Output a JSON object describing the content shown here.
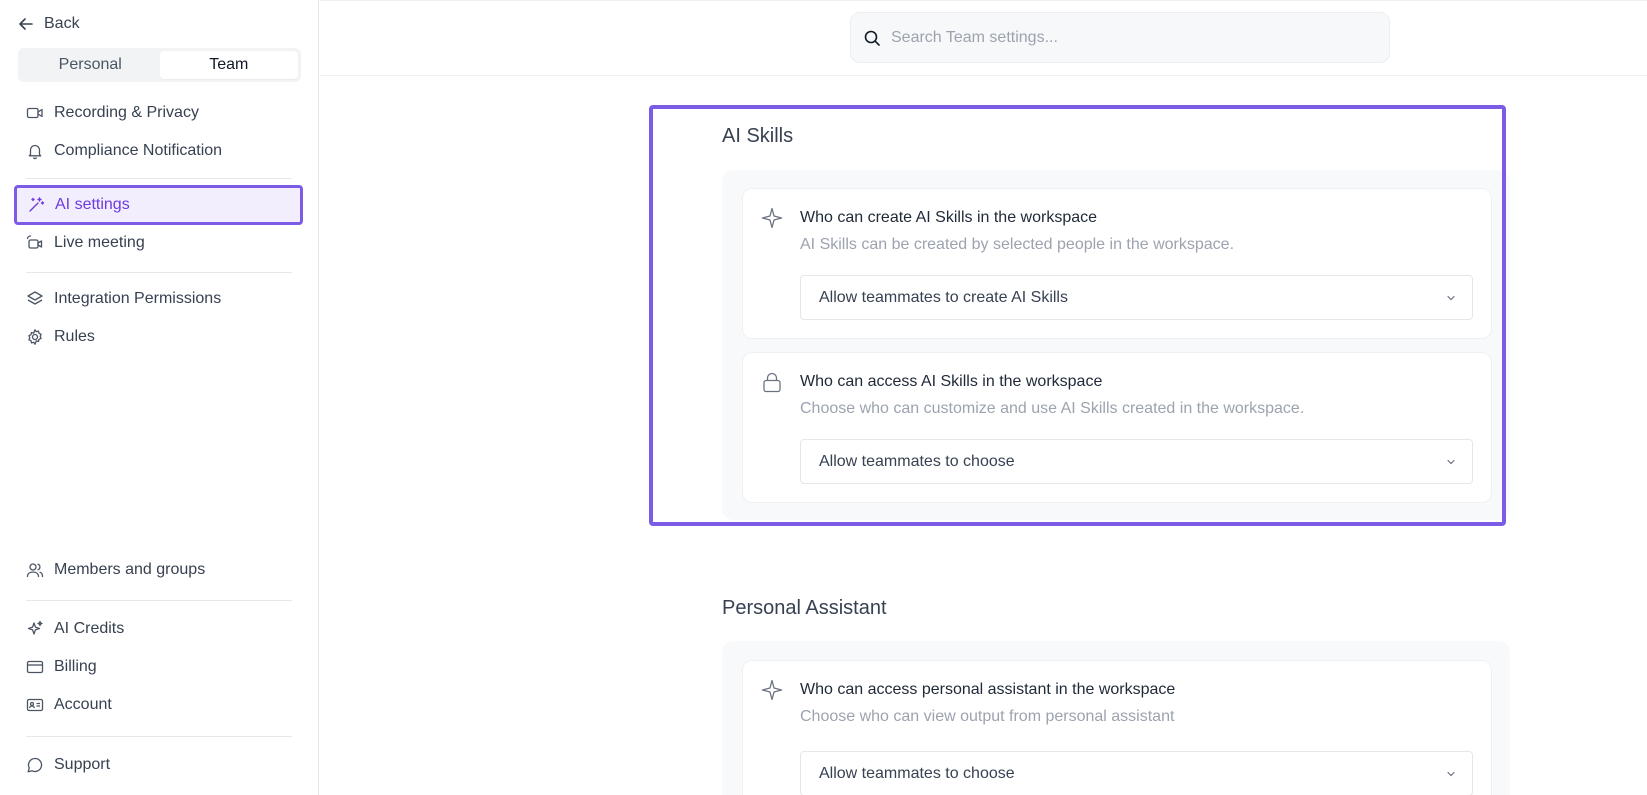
{
  "sidebar": {
    "back_label": "Back",
    "tabs": [
      {
        "label": "Personal",
        "active": false
      },
      {
        "label": "Team",
        "active": true
      }
    ],
    "items": [
      {
        "label": "Recording & Privacy",
        "icon": "video-icon"
      },
      {
        "label": "Compliance Notification",
        "icon": "bell-icon"
      },
      {
        "label": "AI settings",
        "icon": "magic-wand-icon",
        "active": true
      },
      {
        "label": "Live meeting",
        "icon": "live-camera-icon"
      },
      {
        "label": "Integration Permissions",
        "icon": "layers-icon"
      },
      {
        "label": "Rules",
        "icon": "gear-icon"
      },
      {
        "label": "Members and groups",
        "icon": "users-icon"
      },
      {
        "label": "AI Credits",
        "icon": "sparkles-icon"
      },
      {
        "label": "Billing",
        "icon": "credit-card-icon"
      },
      {
        "label": "Account",
        "icon": "id-card-icon"
      },
      {
        "label": "Support",
        "icon": "chat-bubble-icon"
      }
    ]
  },
  "search": {
    "placeholder": "Search Team settings..."
  },
  "sections": [
    {
      "title": "AI Skills",
      "cards": [
        {
          "icon": "sparkle-icon",
          "title": "Who can create AI Skills in the workspace",
          "description": "AI Skills can be created by selected people in the workspace.",
          "selected": "Allow teammates to create AI Skills"
        },
        {
          "icon": "lock-icon",
          "title": "Who can access AI Skills in the workspace",
          "description": "Choose who can customize and use AI Skills created in the workspace.",
          "selected": "Allow teammates to choose"
        }
      ]
    },
    {
      "title": "Personal Assistant",
      "cards": [
        {
          "icon": "sparkle-icon",
          "title": "Who can access personal assistant in the workspace",
          "description": "Choose who can view output from personal assistant",
          "selected": "Allow teammates to choose"
        }
      ]
    }
  ],
  "colors": {
    "accent": "#7c5ce6",
    "accent_text": "#6d3ae0",
    "accent_bg": "#f2eefe"
  }
}
